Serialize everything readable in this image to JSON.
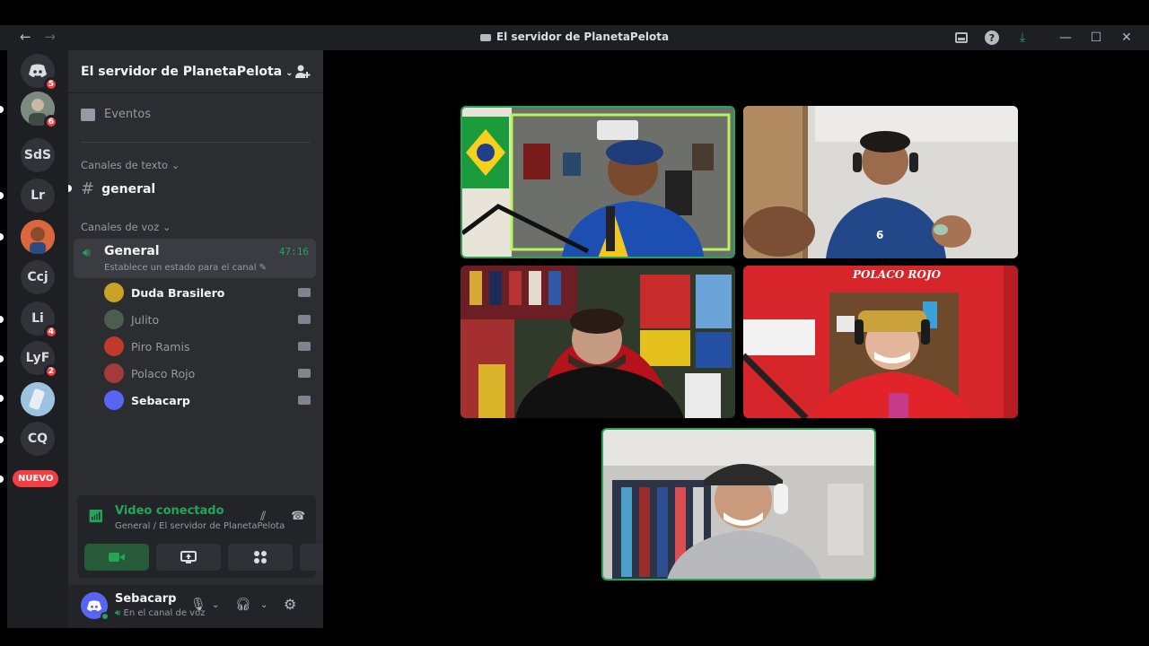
{
  "titlebar": {
    "back_icon": "←",
    "forward_icon": "→",
    "title": "El servidor de PlanetaPelota",
    "download_icon": "⤓",
    "min_icon": "—",
    "max_icon": "☐",
    "close_icon": "✕"
  },
  "servers": {
    "items": [
      {
        "label": "",
        "badge": "5"
      },
      {
        "label": "",
        "badge": "6"
      },
      {
        "label": "SdS",
        "badge": ""
      },
      {
        "label": "Lr",
        "badge": ""
      },
      {
        "label": "",
        "badge": ""
      },
      {
        "label": "Ccj",
        "badge": ""
      },
      {
        "label": "Li",
        "badge": "4"
      },
      {
        "label": "LyF",
        "badge": "2"
      },
      {
        "label": "",
        "badge": ""
      },
      {
        "label": "CQ",
        "badge": ""
      }
    ],
    "nuevo": "NUEVO"
  },
  "sidebar": {
    "guild_name": "El servidor de PlanetaPelota",
    "events": "Eventos",
    "text_category": "Canales de texto",
    "text_channel": "general",
    "voice_category": "Canales de voz",
    "voice_channel": "General",
    "voice_timer": "47:16",
    "voice_status": "Establece un estado para el canal",
    "members": [
      {
        "name": "Duda Brasilero",
        "bold": true,
        "color": "#c9a227"
      },
      {
        "name": "Julito",
        "bold": false,
        "color": "#4b5d4e"
      },
      {
        "name": "Piro Ramis",
        "bold": false,
        "color": "#c0392b"
      },
      {
        "name": "Polaco Rojo",
        "bold": false,
        "color": "#a33b3b"
      },
      {
        "name": "Sebacarp",
        "bold": true,
        "color": "#5865f2"
      }
    ]
  },
  "voice_panel": {
    "title": "Video conectado",
    "subtitle": "General / El servidor de PlanetaPelota"
  },
  "user": {
    "name": "Sebacarp",
    "status": "En el canal de voz"
  },
  "video": {
    "tiles": [
      {
        "label": "POLACO ROJO"
      }
    ]
  }
}
